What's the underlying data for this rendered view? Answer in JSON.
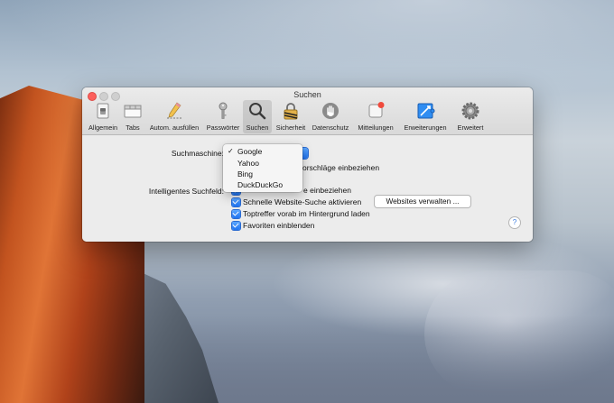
{
  "window": {
    "title": "Suchen"
  },
  "toolbar": {
    "items": [
      {
        "label": "Allgemein",
        "icon": "switch-icon"
      },
      {
        "label": "Tabs",
        "icon": "tabs-icon"
      },
      {
        "label": "Autom. ausfüllen",
        "icon": "pencil-icon"
      },
      {
        "label": "Passwörter",
        "icon": "key-icon"
      },
      {
        "label": "Suchen",
        "icon": "magnifier-icon",
        "selected": true
      },
      {
        "label": "Sicherheit",
        "icon": "lock-icon"
      },
      {
        "label": "Datenschutz",
        "icon": "hand-icon"
      },
      {
        "label": "Mitteilungen",
        "icon": "notification-icon"
      },
      {
        "label": "Erweiterungen",
        "icon": "extensions-icon"
      },
      {
        "label": "Erweitert",
        "icon": "gear-icon"
      }
    ]
  },
  "search_engine": {
    "label": "Suchmaschine:",
    "options": [
      "Google",
      "Yahoo",
      "Bing",
      "DuckDuckGo"
    ],
    "selected": "Google"
  },
  "smart_search": {
    "label": "Intelligentes Suchfeld:",
    "suggestions_partial": "orschläge einbeziehen",
    "safari_partial": "e einbeziehen",
    "quick_website_search": "Schnelle Website-Suche aktivieren",
    "manage_websites": "Websites verwalten ...",
    "preload_top_hit": "Toptreffer vorab im Hintergrund laden",
    "show_favorites": "Favoriten einblenden"
  },
  "help": "?",
  "colors": {
    "accent": "#1f73f0",
    "close": "#fc605c"
  }
}
